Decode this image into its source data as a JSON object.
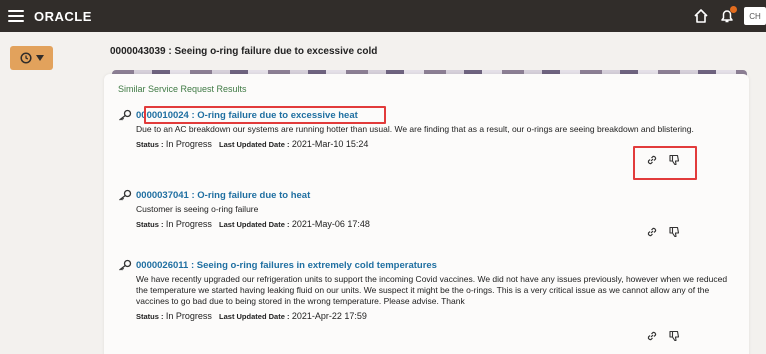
{
  "app": {
    "brand": "ORACLE",
    "avatar_initials": "CH",
    "accent_color": "#e2a25c",
    "notification_color": "#e36c1e"
  },
  "page": {
    "title": "0000043039 : Seeing o-ring failure due to excessive cold"
  },
  "section": {
    "title": "Similar Service Request Results"
  },
  "labels": {
    "status": "Status :",
    "last_updated": "Last Updated Date :"
  },
  "results": [
    {
      "title": "0000010024 : O-ring failure due to excessive heat",
      "description": "Due to an AC breakdown our systems are running hotter than usual. We are finding that as a result, our o-rings are seeing breakdown and blistering.",
      "status": "In Progress",
      "updated": "2021-Mar-10 15:24"
    },
    {
      "title": "0000037041 : O-ring failure due to heat",
      "description": "Customer is seeing o-ring failure",
      "status": "In Progress",
      "updated": "2021-May-06 17:48"
    },
    {
      "title": "0000026011 : Seeing o-ring failures in extremely cold temperatures",
      "description": "We have recently upgraded our refrigeration units to support the incoming Covid vaccines. We did not have any issues previously, however when we reduced the temperature we started having leaking fluid on our units. We suspect it might be the o-rings. This is a very critical issue as we cannot allow any of the vaccines to go bad due to being stored in the wrong temperature. Please advise. Thank",
      "status": "In Progress",
      "updated": "2021-Apr-22 17:59"
    }
  ],
  "icons": {
    "menu": "hamburger-icon",
    "home": "home-icon",
    "notifications": "bell-icon",
    "history": "clock-icon",
    "result": "key-icon",
    "link": "link-icon",
    "dislike": "thumbs-down-icon"
  }
}
